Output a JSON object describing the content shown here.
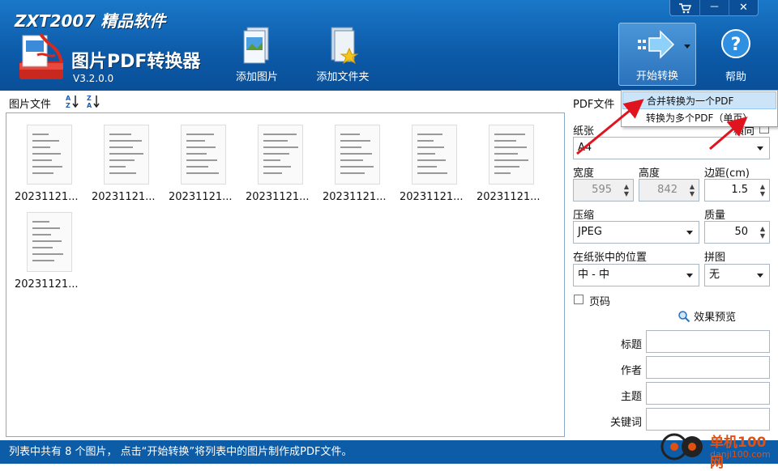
{
  "header": {
    "brand": "ZXT2007 精品软件",
    "app_title": "图片PDF转换器",
    "version": "V3.2.0.0",
    "toolbar": {
      "add_image": "添加图片",
      "add_folder": "添加文件夹",
      "start_convert": "开始转换",
      "help": "帮助"
    },
    "window_controls": {
      "cart": "cart-icon",
      "minimize": "－",
      "close": "✕"
    }
  },
  "left_panel": {
    "label": "图片文件",
    "thumbnails": [
      {
        "caption": "20231121..."
      },
      {
        "caption": "20231121..."
      },
      {
        "caption": "20231121..."
      },
      {
        "caption": "20231121..."
      },
      {
        "caption": "20231121..."
      },
      {
        "caption": "20231121..."
      },
      {
        "caption": "20231121..."
      },
      {
        "caption": "20231121..."
      }
    ]
  },
  "right_panel": {
    "title": "PDF文件",
    "paper_label": "纸张",
    "paper_value": "A4",
    "landscape_label": "横向",
    "width_label": "宽度",
    "width_value": "595",
    "height_label": "高度",
    "height_value": "842",
    "margin_label": "边距(cm)",
    "margin_value": "1.5",
    "compress_label": "压缩",
    "compress_value": "JPEG",
    "quality_label": "质量",
    "quality_value": "50",
    "position_label": "在纸张中的位置",
    "position_value": "中 - 中",
    "tile_label": "拼图",
    "tile_value": "无",
    "page_number_label": "页码",
    "preview_label": "效果预览",
    "meta": {
      "title_label": "标题",
      "author_label": "作者",
      "subject_label": "主题",
      "keywords_label": "关键词"
    }
  },
  "dropdown_menu": {
    "items": [
      "合并转换为一个PDF",
      "转换为多个PDF（单页）"
    ]
  },
  "statusbar": {
    "text": "列表中共有 8 个图片， 点击“开始转换”将列表中的图片制作成PDF文件。"
  },
  "watermark": {
    "line1": "单机100网",
    "line2": "danji100.com"
  },
  "colors": {
    "header": "#0c5aa8",
    "status": "#0d5ca8",
    "annotation_arrow": "#e0141e"
  }
}
